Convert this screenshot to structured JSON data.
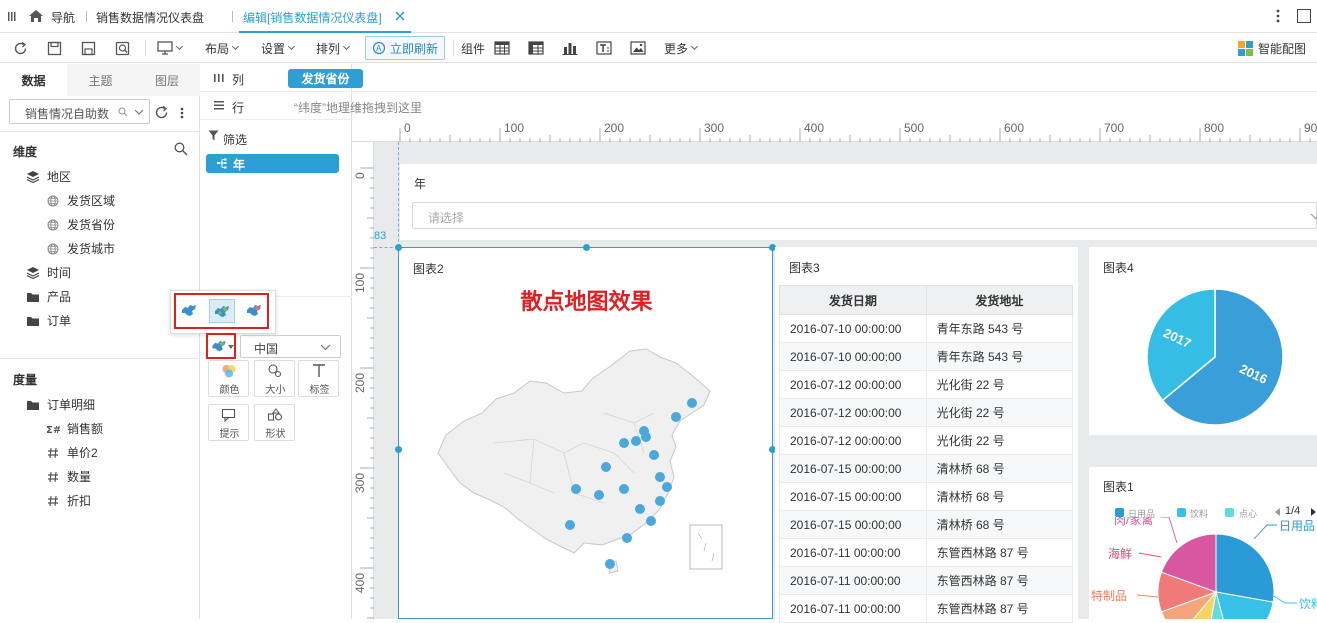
{
  "tabbar": {
    "nav_label": "导航",
    "tab1": "销售数据情况仪表盘",
    "tab2": "编辑[销售数据情况仪表盘]"
  },
  "toolbar": {
    "layout": "布局",
    "settings": "设置",
    "arrange": "排列",
    "refresh": "立即刷新",
    "components": "组件",
    "more": "更多",
    "smart": "智能配图"
  },
  "left": {
    "tabs": [
      "数据",
      "主题",
      "图层"
    ],
    "dataset": "销售情况自助数",
    "dim_title": "维度",
    "dims": [
      {
        "label": "地区",
        "level": 0,
        "icon": "layers"
      },
      {
        "label": "发货区域",
        "level": 1,
        "icon": "globe"
      },
      {
        "label": "发货省份",
        "level": 1,
        "icon": "globe"
      },
      {
        "label": "发货城市",
        "level": 1,
        "icon": "globe"
      },
      {
        "label": "时间",
        "level": 0,
        "icon": "layers"
      },
      {
        "label": "产品",
        "level": 0,
        "icon": "folder"
      },
      {
        "label": "订单",
        "level": 0,
        "icon": "folder"
      }
    ],
    "measure_title": "度量",
    "measures": [
      {
        "label": "订单明细",
        "level": 0,
        "icon": "folder"
      },
      {
        "label": "销售额",
        "level": 1,
        "icon": "hash-sum"
      },
      {
        "label": "单价2",
        "level": 1,
        "icon": "hash"
      },
      {
        "label": "数量",
        "level": 1,
        "icon": "hash"
      },
      {
        "label": "折扣",
        "level": 1,
        "icon": "hash"
      }
    ]
  },
  "middle": {
    "col_label": "列",
    "col_chip": "发货省份",
    "row_label": "行",
    "row_hint": "“纬度”地理维拖拽到这里",
    "filter_label": "筛选",
    "filter_chip": "年",
    "map_select": "中国",
    "props": [
      "颜色",
      "大小",
      "标签",
      "提示",
      "形状"
    ]
  },
  "ruler": {
    "h_ticks": [
      "0",
      "100",
      "200",
      "300",
      "400",
      "500",
      "600",
      "700",
      "800",
      "900"
    ],
    "v_ticks": [
      "0",
      "100",
      "200",
      "300",
      "400"
    ],
    "marker": "83"
  },
  "filter_card": {
    "title": "年",
    "placeholder": "请选择"
  },
  "chart2": {
    "title": "图表2",
    "heading": "散点地图效果"
  },
  "chart3": {
    "title": "图表3",
    "headers": [
      "发货日期",
      "发货地址"
    ],
    "rows": [
      [
        "2016-07-10 00:00:00",
        "青年东路 543 号"
      ],
      [
        "2016-07-10 00:00:00",
        "青年东路 543 号"
      ],
      [
        "2016-07-12 00:00:00",
        "光化街 22 号"
      ],
      [
        "2016-07-12 00:00:00",
        "光化街 22 号"
      ],
      [
        "2016-07-12 00:00:00",
        "光化街 22 号"
      ],
      [
        "2016-07-15 00:00:00",
        "清林桥 68 号"
      ],
      [
        "2016-07-15 00:00:00",
        "清林桥 68 号"
      ],
      [
        "2016-07-15 00:00:00",
        "清林桥 68 号"
      ],
      [
        "2016-07-11 00:00:00",
        "东管西林路 87 号"
      ],
      [
        "2016-07-11 00:00:00",
        "东管西林路 87 号"
      ],
      [
        "2016-07-11 00:00:00",
        "东管西林路 87 号"
      ]
    ]
  },
  "chart4": {
    "title": "图表4",
    "slices": [
      {
        "label": "2016",
        "value": 64,
        "color": "#3a9fd8"
      },
      {
        "label": "2017",
        "value": 36,
        "color": "#35bde6"
      }
    ]
  },
  "chart1": {
    "title": "图表1",
    "legend": [
      "日用品",
      "饮料",
      "点心"
    ],
    "pager": "1/4",
    "labels": [
      "日用品",
      "饮料",
      "肉/家禽",
      "海鲜",
      "特制品"
    ],
    "colors": {
      "daily": "#2b9bd8",
      "drinks": "#38c1e8",
      "snack": "#5fdcdc",
      "meat": "#d9579e",
      "seafood": "#f07a7a",
      "special": "#f6a57a",
      "yellow": "#f8d35e"
    }
  },
  "colors": {
    "accent": "#2e9fd2",
    "red_frame": "#e02020",
    "map_dot": "#4aa8dc",
    "title_red": "#e02020"
  }
}
